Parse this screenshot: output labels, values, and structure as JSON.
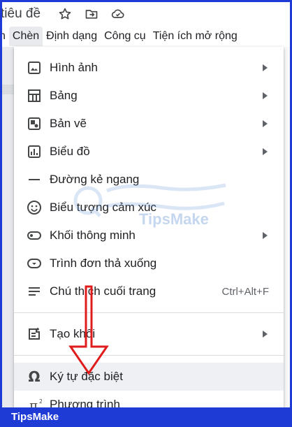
{
  "document": {
    "title": "tiêu đề"
  },
  "menubar": {
    "items": [
      "n",
      "Chèn",
      "Định dạng",
      "Công cụ",
      "Tiện ích mở rộng"
    ]
  },
  "insert_menu": {
    "items": [
      {
        "label": "Hình ảnh",
        "icon": "image-icon",
        "submenu": true
      },
      {
        "label": "Bảng",
        "icon": "table-icon",
        "submenu": true
      },
      {
        "label": "Bản vẽ",
        "icon": "drawing-icon",
        "submenu": true
      },
      {
        "label": "Biểu đồ",
        "icon": "chart-icon",
        "submenu": true
      },
      {
        "label": "Đường kẻ ngang",
        "icon": "horizontal-line-icon",
        "submenu": false
      },
      {
        "label": "Biểu tượng cảm xúc",
        "icon": "emoji-icon",
        "submenu": false
      },
      {
        "label": "Khối thông minh",
        "icon": "smart-chip-icon",
        "submenu": true
      },
      {
        "label": "Trình đơn thả xuống",
        "icon": "dropdown-icon",
        "submenu": false
      },
      {
        "label": "Chú thích cuối trang",
        "icon": "footnote-icon",
        "shortcut": "Ctrl+Alt+F"
      },
      {
        "label": "Tạo khối",
        "icon": "building-block-icon",
        "submenu": true
      },
      {
        "label": "Ký tự đặc biệt",
        "icon": "omega-icon",
        "highlighted": true
      },
      {
        "label": "Phương trình",
        "icon": "pi-icon"
      }
    ]
  },
  "watermark": {
    "text": "TipsMake"
  },
  "footer": {
    "brand": "TipsMake"
  },
  "colors": {
    "frame_border": "#1f3bd6",
    "highlight": "#eef0f3",
    "annotation_arrow": "#e01b1b"
  }
}
